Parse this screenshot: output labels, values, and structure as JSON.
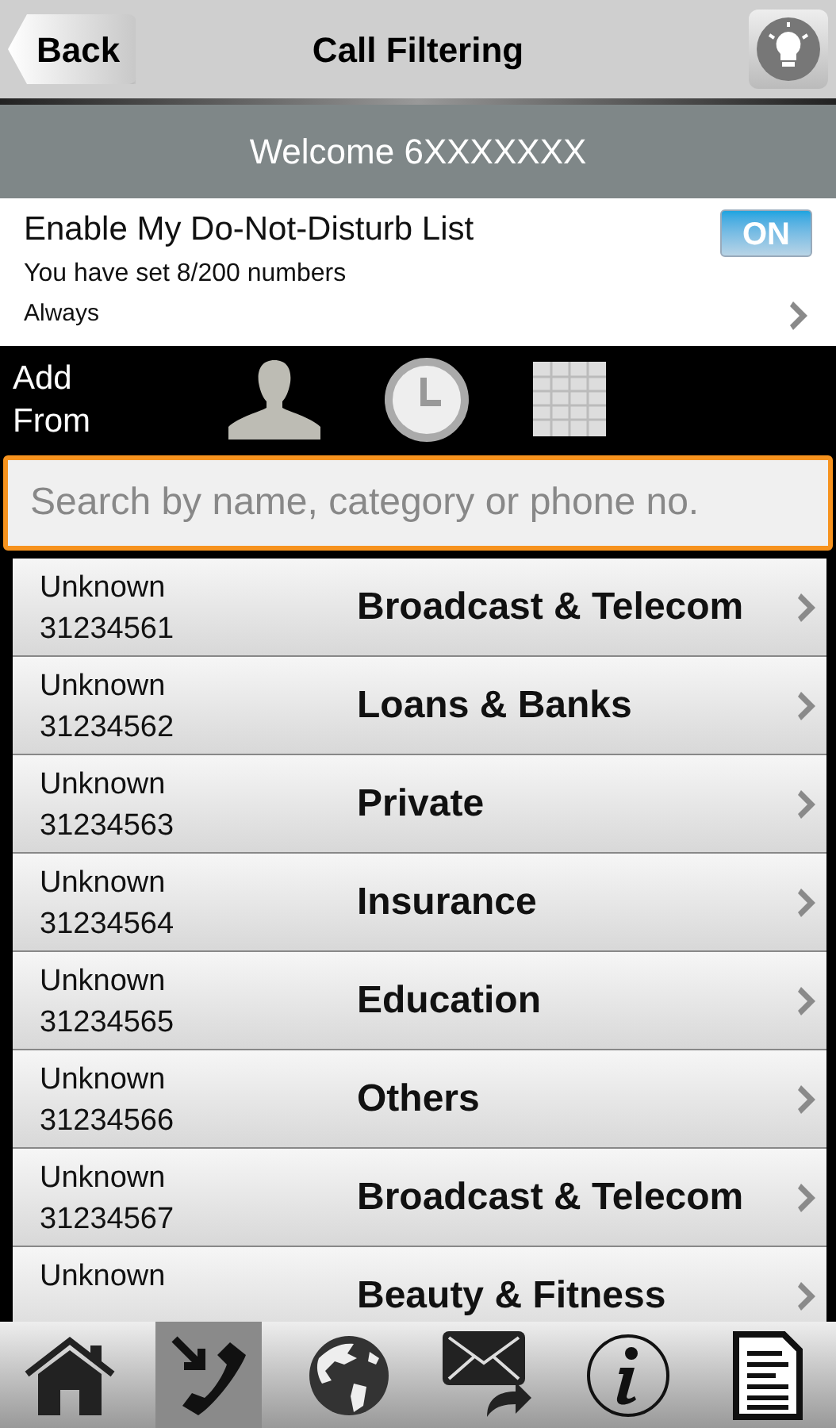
{
  "header": {
    "back": "Back",
    "title": "Call Filtering"
  },
  "welcome": "Welcome 6XXXXXXX",
  "dnd": {
    "title": "Enable My Do-Not-Disturb List",
    "toggle": {
      "label": "ON",
      "on": true
    },
    "count": "You have set 8/200 numbers",
    "schedule": "Always"
  },
  "add_from": {
    "label": "Add From"
  },
  "search": {
    "placeholder": "Search by name, category or phone no."
  },
  "entries": [
    {
      "name": "Unknown",
      "number": "31234561",
      "category": "Broadcast & Telecom"
    },
    {
      "name": "Unknown",
      "number": "31234562",
      "category": "Loans & Banks"
    },
    {
      "name": "Unknown",
      "number": "31234563",
      "category": "Private"
    },
    {
      "name": "Unknown",
      "number": "31234564",
      "category": "Insurance"
    },
    {
      "name": "Unknown",
      "number": "31234565",
      "category": "Education"
    },
    {
      "name": "Unknown",
      "number": "31234566",
      "category": "Others"
    },
    {
      "name": "Unknown",
      "number": "31234567",
      "category": "Broadcast & Telecom"
    },
    {
      "name": "Unknown",
      "category": "Beauty & Fitness"
    }
  ],
  "tab_bar": [
    {
      "kind": "home",
      "selected": false
    },
    {
      "kind": "call",
      "selected": true
    },
    {
      "kind": "globe",
      "selected": false
    },
    {
      "kind": "mail",
      "selected": false
    },
    {
      "kind": "info",
      "selected": false
    },
    {
      "kind": "document",
      "selected": false
    }
  ]
}
